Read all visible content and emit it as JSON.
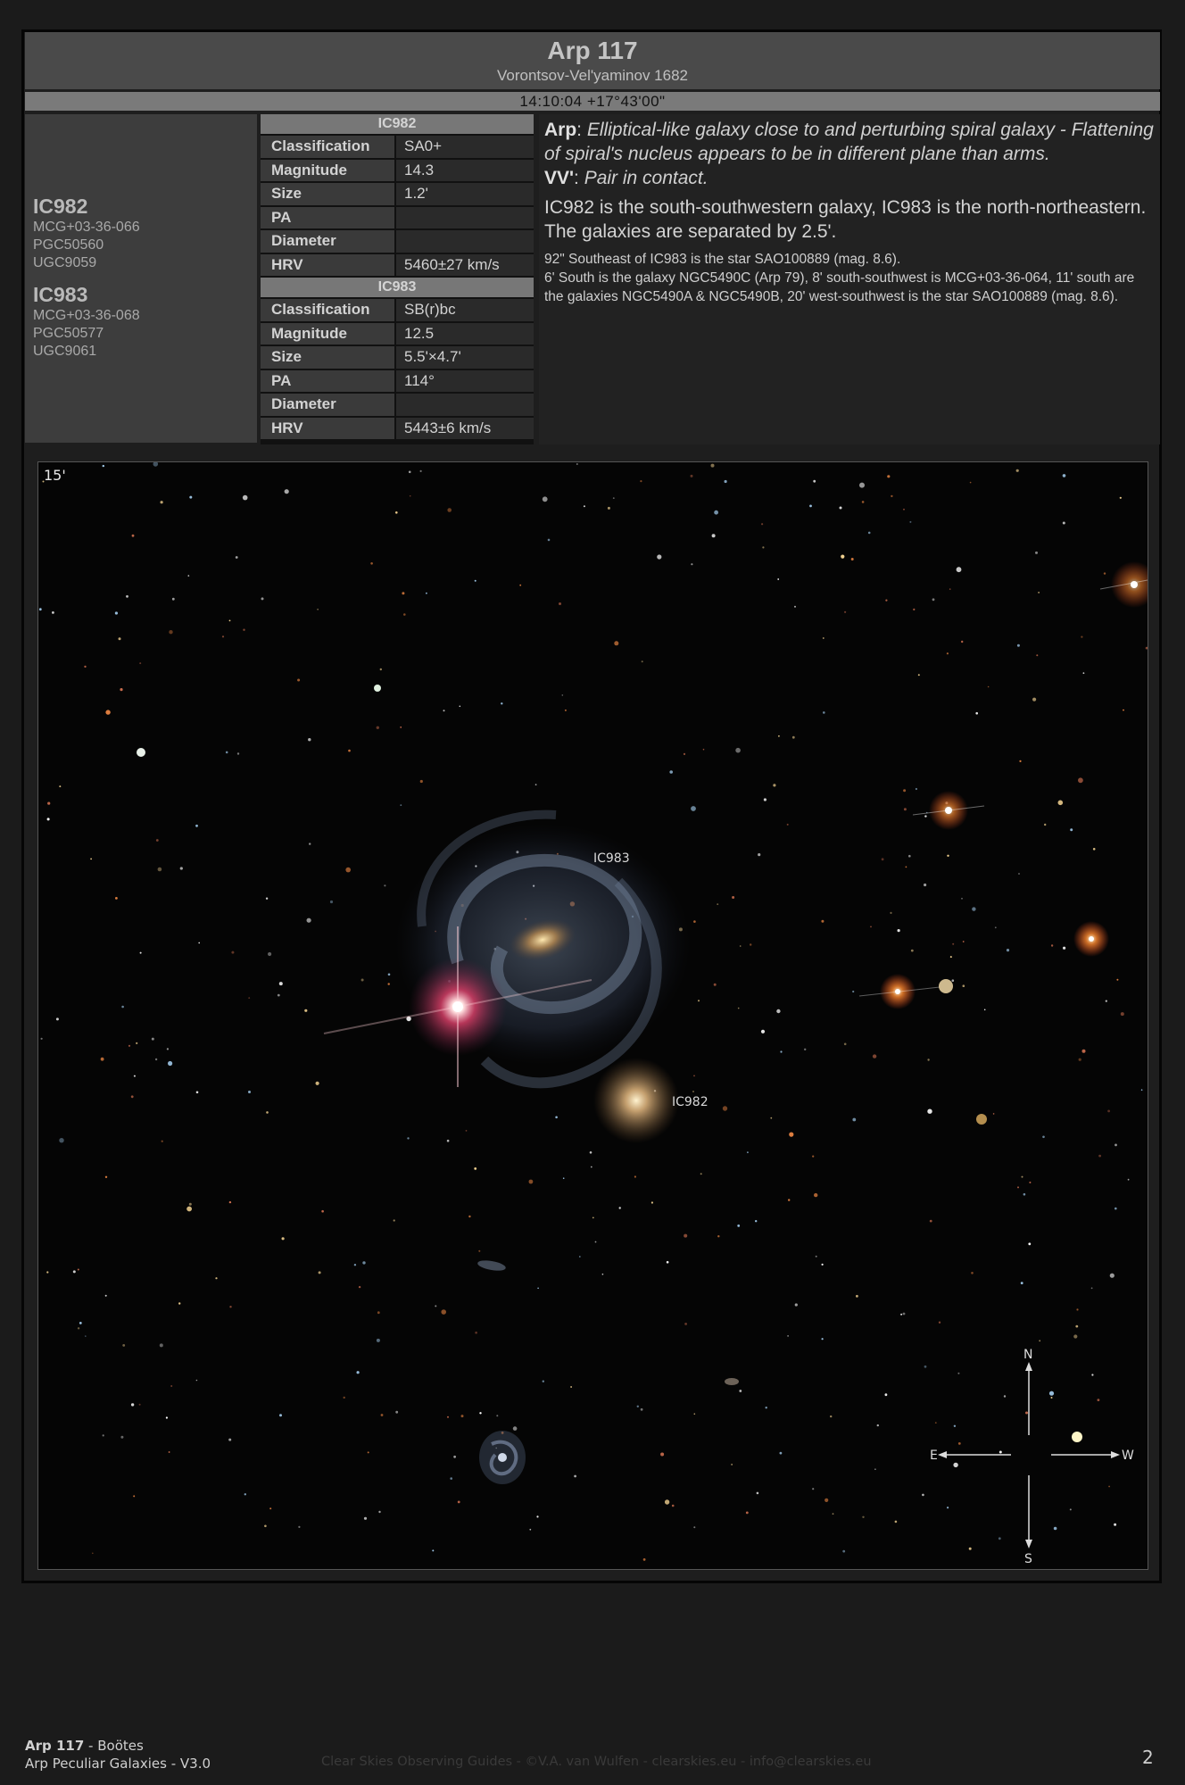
{
  "header": {
    "title": "Arp 117",
    "subtitle": "Vorontsov-Vel'yaminov 1682",
    "coordinates": "14:10:04 +17°43'00\""
  },
  "objects": [
    {
      "name": "IC982",
      "designations": [
        "MCG+03-36-066",
        "PGC50560",
        "UGC9059"
      ],
      "table": {
        "Classification": "SA0+",
        "Magnitude": "14.3",
        "Size": "1.2'",
        "PA": "",
        "Diameter": "",
        "HRV": "5460±27 km/s"
      }
    },
    {
      "name": "IC983",
      "designations": [
        "MCG+03-36-068",
        "PGC50577",
        "UGC9061"
      ],
      "table": {
        "Classification": "SB(r)bc",
        "Magnitude": "12.5",
        "Size": "5.5'×4.7'",
        "PA": "114°",
        "Diameter": "",
        "HRV": "5443±6 km/s"
      }
    }
  ],
  "table_labels": {
    "classification": "Classification",
    "magnitude": "Magnitude",
    "size": "Size",
    "pa": "PA",
    "diameter": "Diameter",
    "hrv": "HRV"
  },
  "description": {
    "arp_label": "Arp",
    "arp_text": "Elliptical-like galaxy close to and perturbing spiral galaxy - Flattening of spiral's nucleus appears to be in different plane than arms.",
    "vv_label": "VV'",
    "vv_text": "Pair in contact.",
    "para1": "IC982 is the south-southwestern galaxy, IC983 is the north-northeastern.",
    "para2": "The galaxies are separated by 2.5'.",
    "note1": "92\" Southeast of IC983 is the star SAO100889 (mag. 8.6).",
    "note2": "6' South is the galaxy NGC5490C (Arp 79), 8' south-southwest is MCG+03-36-064, 11' south are the galaxies NGC5490A & NGC5490B, 20' west-southwest is the star SAO100889 (mag. 8.6)."
  },
  "image": {
    "scale_label": "15'",
    "label_ic983": "IC983",
    "label_ic982": "IC982",
    "compass": {
      "n": "N",
      "s": "S",
      "e": "E",
      "w": "W"
    }
  },
  "footer": {
    "object": "Arp 117",
    "constellation": " - Boötes",
    "catalog": "Arp Peculiar Galaxies - V3.0",
    "credit": "Clear Skies Observing Guides - ©V.A. van Wulfen - clearskies.eu - info@clearskies.eu",
    "page": "2"
  },
  "colors": {
    "background": "#1b1b1b",
    "header": "#4a4a4a",
    "coord_bar": "#7a7a7a",
    "table_header": "#777777"
  }
}
